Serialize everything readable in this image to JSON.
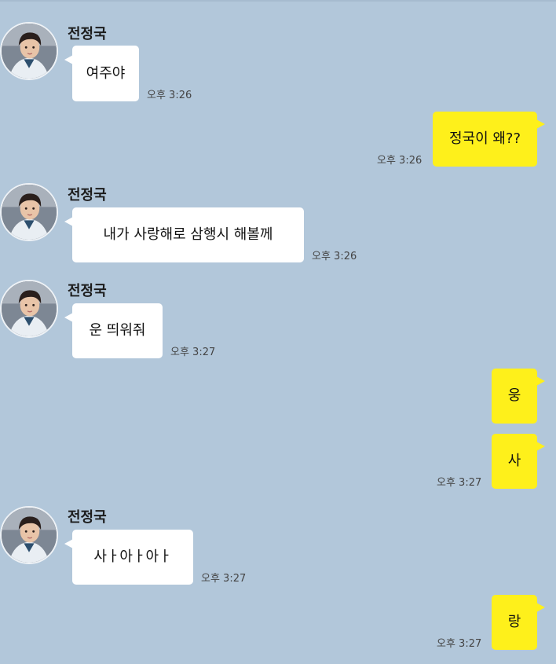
{
  "chat": {
    "contact_name": "전정국",
    "messages": [
      {
        "text": "여주야",
        "time": "오후 3:26"
      },
      {
        "text": "정국이 왜??",
        "time": "오후 3:26"
      },
      {
        "text": "내가 사랑해로 삼행시 해볼께",
        "time": "오후 3:26"
      },
      {
        "text": "운 띄워줘",
        "time": "오후 3:27"
      },
      {
        "text": "웅"
      },
      {
        "text": "사",
        "time": "오후 3:27"
      },
      {
        "text": "사ㅏ아ㅏ아ㅏ",
        "time": "오후 3:27"
      },
      {
        "text": "랑",
        "time": "오후 3:27"
      }
    ]
  },
  "colors": {
    "background": "#b2c7da",
    "incoming_bubble": "#ffffff",
    "outgoing_bubble": "#fef01b"
  },
  "icons": {
    "avatar": "profile-photo"
  }
}
